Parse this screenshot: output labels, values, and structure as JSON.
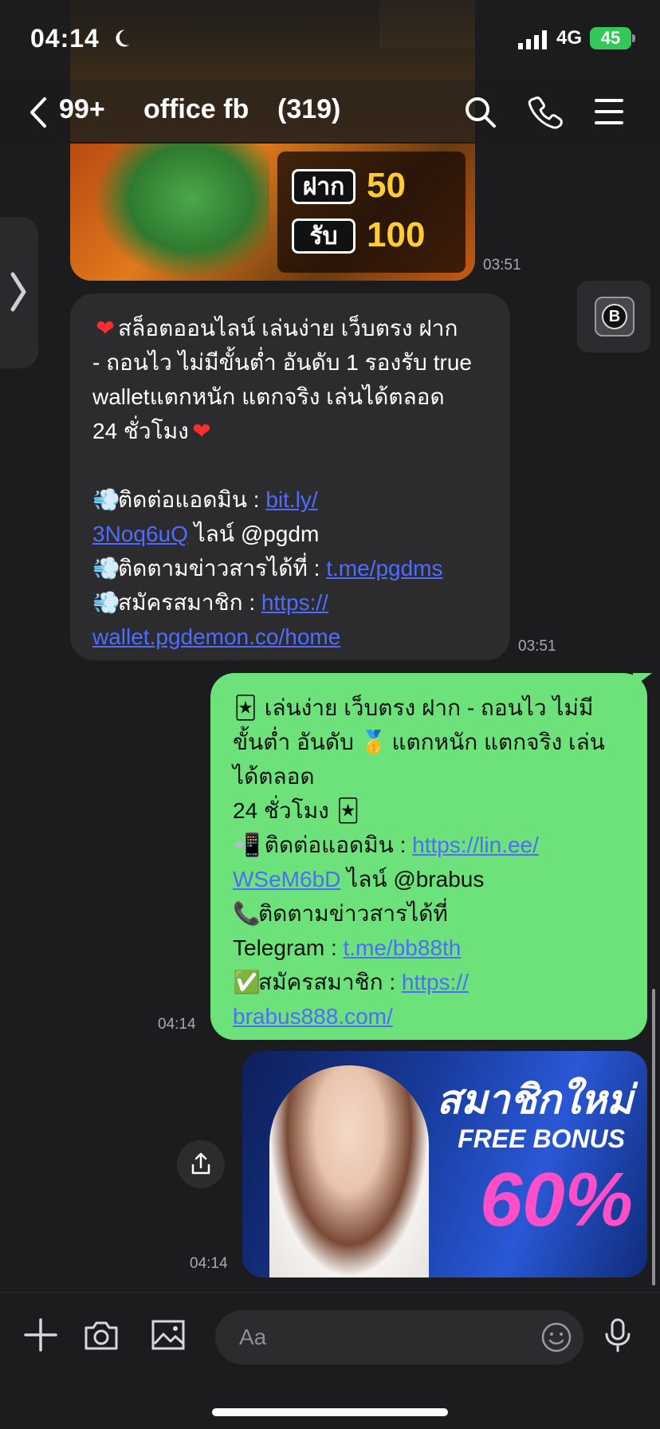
{
  "status_bar": {
    "time": "04:14",
    "network": "4G",
    "battery": "45"
  },
  "header": {
    "unread": "99+",
    "title": "office fb",
    "member_count": "(319)"
  },
  "messages": {
    "image1": {
      "deposit_label": "ฝาก",
      "deposit_value": "50",
      "receive_label": "รับ",
      "receive_value": "100",
      "time": "03:51"
    },
    "incoming": {
      "time": "03:51",
      "line1": "สล็อตออนไลน์ เล่นง่าย เว็บตรง ฝาก",
      "line2": "- ถอนไว ไม่มีขั้นต่ำ อันดับ 1 รองรับ true",
      "line3": "walletแตกหนัก แตกจริง เล่นได้ตลอด",
      "line4": "24 ชั่วโมง",
      "contact_label": "ติดต่อแอดมิน : ",
      "contact_link_a": "bit.ly/",
      "contact_link_b": "3Noq6uQ",
      "contact_line": " ไลน์ @pgdm",
      "news_label": "ติดตามข่าวสารได้ที่ : ",
      "news_link": "t.me/pgdms",
      "signup_label": "สมัครสมาชิก : ",
      "signup_link_a": "https://",
      "signup_link_b": "wallet.pgdemon.co/home"
    },
    "outgoing": {
      "time": "04:14",
      "line1": " เล่นง่าย เว็บตรง ฝาก - ถอนไว ไม่มี",
      "line2a": "ขั้นต่ำ อันดับ ",
      "line2b": " แตกหนัก แตกจริง เล่น",
      "line3": "ได้ตลอด",
      "line4": "24 ชั่วโมง ",
      "contact_label": " ติดต่อแอดมิน : ",
      "contact_link_a": "https://lin.ee/",
      "contact_link_b": "WSeM6bD",
      "contact_line": "  ไลน์ @brabus",
      "news_label": "ติดตามข่าวสารได้ที่",
      "telegram_label": "Telegram : ",
      "telegram_link": "t.me/bb88th",
      "signup_label": "สมัครสมาชิก : ",
      "signup_link_a": "https://",
      "signup_link_b": "brabus888.com/"
    },
    "image2": {
      "headline": "สมาชิกใหม่",
      "subline": "FREE BONUS",
      "percent": "60%",
      "time": "04:14"
    }
  },
  "float_button": {
    "logo_letter": "B"
  },
  "composer": {
    "placeholder": "Aa"
  },
  "icons": {
    "back": "chevron-left-icon",
    "search": "search-icon",
    "call": "phone-icon",
    "menu": "menu-icon",
    "plus": "plus-icon",
    "camera": "camera-icon",
    "gallery": "image-icon",
    "emoji": "emoji-icon",
    "mic": "microphone-icon",
    "share": "share-icon"
  },
  "colors": {
    "background": "#1c1c1e",
    "incoming_bubble": "#2c2c2e",
    "outgoing_bubble": "#6de27a",
    "link": "#4e6cff",
    "battery": "#34c759"
  }
}
